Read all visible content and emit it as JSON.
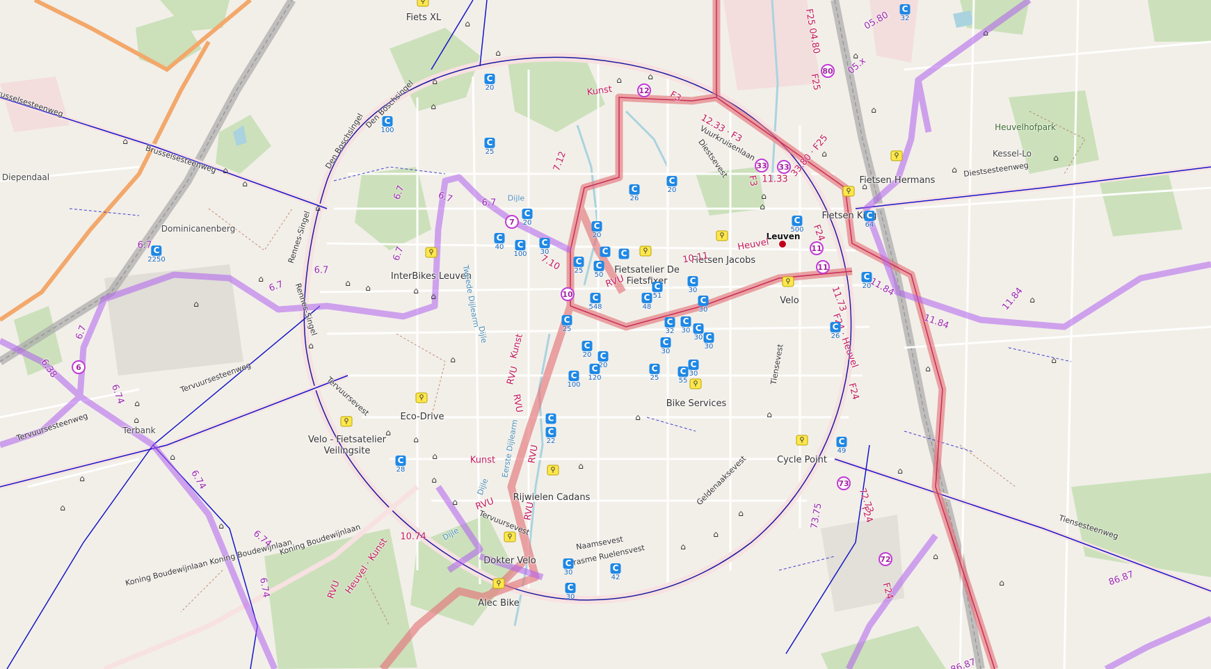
{
  "places": [
    {
      "name": "Diependaal"
    },
    {
      "name": "Dominicanenberg"
    },
    {
      "name": "Terbank"
    },
    {
      "name": "Kessel-Lo"
    },
    {
      "name": "Heuvelhofpark"
    }
  ],
  "city": {
    "name": "Leuven"
  },
  "shops": [
    {
      "name": "Fiets XL"
    },
    {
      "name": "InterBikes Leuven"
    },
    {
      "name": "Fietsatelier De Fietsfixer"
    },
    {
      "name": "Fietsen Jacobs"
    },
    {
      "name": "Fietsen Hermans"
    },
    {
      "name": "Fietsen King"
    },
    {
      "name": "Velo"
    },
    {
      "name": "Eco-Drive"
    },
    {
      "name": "Velo - Fietsatelier Veilingsite"
    },
    {
      "name": "Bike Services"
    },
    {
      "name": "Rijwielen Cadans"
    },
    {
      "name": "Cycle Point"
    },
    {
      "name": "Dokter Velo"
    },
    {
      "name": "Alec Bike"
    }
  ],
  "streets": [
    {
      "name": "Brusselsesteenweg"
    },
    {
      "name": "Brusselsesteenweg"
    },
    {
      "name": "Den Boschsingel"
    },
    {
      "name": "Den Boschsingel"
    },
    {
      "name": "Rennes-Singel"
    },
    {
      "name": "Rennes-Singel"
    },
    {
      "name": "Tervuursesteenweg"
    },
    {
      "name": "Tervuursesteenweg"
    },
    {
      "name": "Tervuursevest"
    },
    {
      "name": "Tervuursevest"
    },
    {
      "name": "Koning Boudewijnlaan"
    },
    {
      "name": "Koning Boudewijnlaan Koning Boudewijnlaan"
    },
    {
      "name": "Naamsevest"
    },
    {
      "name": "Erasme Ruelensvest"
    },
    {
      "name": "Geldenaaksevest"
    },
    {
      "name": "Tiensevest"
    },
    {
      "name": "Diestsevest"
    },
    {
      "name": "Vuurkruisenlaan"
    },
    {
      "name": "Diestsesteenweg"
    },
    {
      "name": "Tiensesteenweg"
    },
    {
      "name": "Dijle"
    },
    {
      "name": "Dijle"
    },
    {
      "name": "Tweede Dijlearm"
    },
    {
      "name": "Dijle"
    },
    {
      "name": "Dijle"
    },
    {
      "name": "Eerste Dijlearm"
    }
  ],
  "route_labels": [
    {
      "text": "Kunst"
    },
    {
      "text": "F3"
    },
    {
      "text": "12.33 · F3"
    },
    {
      "text": "F3"
    },
    {
      "text": "11.33"
    },
    {
      "text": "7.12"
    },
    {
      "text": "7.10"
    },
    {
      "text": "RVU"
    },
    {
      "text": "10.11"
    },
    {
      "text": "Heuvel"
    },
    {
      "text": "Kunst"
    },
    {
      "text": "RVU"
    },
    {
      "text": "RVU"
    },
    {
      "text": "RVU"
    },
    {
      "text": "Kunst"
    },
    {
      "text": "RVU"
    },
    {
      "text": "RVU"
    },
    {
      "text": "Heuvel · Kunst"
    },
    {
      "text": "RVU"
    },
    {
      "text": "10.74"
    },
    {
      "text": "F24"
    },
    {
      "text": "11.73"
    },
    {
      "text": "F24 · Heuvel"
    },
    {
      "text": "F24"
    },
    {
      "text": "72.73"
    },
    {
      "text": "F24"
    },
    {
      "text": "F24"
    },
    {
      "text": "F25"
    },
    {
      "text": "F25 04.80"
    },
    {
      "text": "33.80 · F25"
    },
    {
      "text": "05.80"
    },
    {
      "text": "05.x"
    },
    {
      "text": "6.7"
    },
    {
      "text": "6.7"
    },
    {
      "text": "6.7"
    },
    {
      "text": "6.7"
    },
    {
      "text": "6.7"
    },
    {
      "text": "6.7"
    },
    {
      "text": "6.7"
    },
    {
      "text": "6.7"
    },
    {
      "text": "6.38"
    },
    {
      "text": "6.74"
    },
    {
      "text": "6.74"
    },
    {
      "text": "6.74"
    },
    {
      "text": "6.74"
    },
    {
      "text": "11.84"
    },
    {
      "text": "11.84"
    },
    {
      "text": "11.84"
    },
    {
      "text": "73.75"
    },
    {
      "text": "86.87"
    },
    {
      "text": "86.87"
    }
  ],
  "nodes": [
    {
      "num": "12"
    },
    {
      "num": "33"
    },
    {
      "num": "33"
    },
    {
      "num": "80"
    },
    {
      "num": "7"
    },
    {
      "num": "10"
    },
    {
      "num": "11"
    },
    {
      "num": "11"
    },
    {
      "num": "6"
    },
    {
      "num": "73"
    },
    {
      "num": "72"
    }
  ],
  "parkings": [
    {
      "cap": "32"
    },
    {
      "cap": "20"
    },
    {
      "cap": "100"
    },
    {
      "cap": "25"
    },
    {
      "cap": "2250"
    },
    {
      "cap": "20"
    },
    {
      "cap": "40"
    },
    {
      "cap": "100"
    },
    {
      "cap": "30"
    },
    {
      "cap": "20"
    },
    {
      "cap": "26"
    },
    {
      "cap": "20"
    },
    {
      "cap": "500"
    },
    {
      "cap": "64"
    },
    {
      "cap": "20"
    },
    {
      "cap": "26"
    },
    {
      "cap": ""
    },
    {
      "cap": ""
    },
    {
      "cap": "25"
    },
    {
      "cap": "50"
    },
    {
      "cap": "548"
    },
    {
      "cap": "48"
    },
    {
      "cap": "51"
    },
    {
      "cap": "30"
    },
    {
      "cap": "30"
    },
    {
      "cap": "25"
    },
    {
      "cap": "32"
    },
    {
      "cap": "30"
    },
    {
      "cap": "30"
    },
    {
      "cap": "30"
    },
    {
      "cap": "30"
    },
    {
      "cap": "20"
    },
    {
      "cap": "20"
    },
    {
      "cap": "100"
    },
    {
      "cap": "120"
    },
    {
      "cap": "25"
    },
    {
      "cap": "55"
    },
    {
      "cap": "30"
    },
    {
      "cap": ""
    },
    {
      "cap": "22"
    },
    {
      "cap": "28"
    },
    {
      "cap": "30"
    },
    {
      "cap": "42"
    },
    {
      "cap": "30"
    },
    {
      "cap": "49"
    }
  ],
  "colors": {
    "land": "#f2efe9",
    "green": "#add19e",
    "road": "#ffffff",
    "ring": "#fcd6a4",
    "knooppunt": "#b44ce6",
    "fietssnelweg": "#e06c73",
    "cycleway": "#0000ff",
    "rail": "#999999",
    "water": "#aad3df",
    "parking": "#1e88e5",
    "shop": "#fde74c"
  }
}
